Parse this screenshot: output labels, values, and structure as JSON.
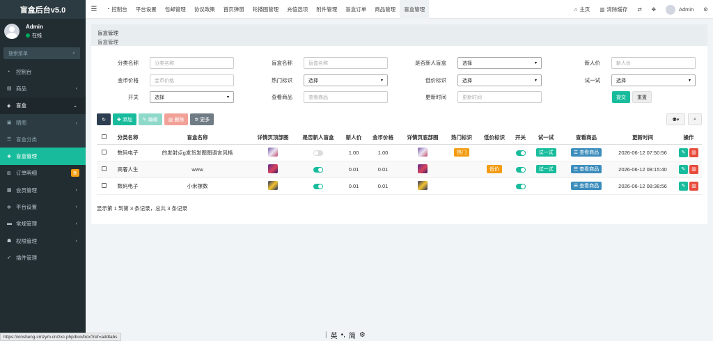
{
  "app": {
    "title": "盲盒后台v5.0"
  },
  "user": {
    "name": "Admin",
    "status": "在线"
  },
  "sidebar": {
    "search_placeholder": "搜索菜单",
    "items": [
      {
        "label": "控制台",
        "icon": "dashboard-icon"
      },
      {
        "label": "商品",
        "icon": "shop-icon",
        "chevron": "‹"
      },
      {
        "label": "盲盒",
        "icon": "cube-icon",
        "chevron": "⌄"
      },
      {
        "label": "晒图",
        "icon": "image-icon",
        "chevron": "‹"
      },
      {
        "label": "盲盒分类",
        "icon": "list-icon"
      },
      {
        "label": "盲盒管理",
        "icon": "cubes-icon"
      },
      {
        "label": "订单明细",
        "icon": "cart-icon",
        "badge": "新"
      },
      {
        "label": "会员管理",
        "icon": "users-icon",
        "chevron": "‹"
      },
      {
        "label": "平台设置",
        "icon": "cog-icon",
        "chevron": "‹"
      },
      {
        "label": "常规管理",
        "icon": "briefcase-icon",
        "chevron": "‹"
      },
      {
        "label": "权限管理",
        "icon": "group-icon",
        "chevron": "‹"
      },
      {
        "label": "插件管理",
        "icon": "rocket-icon"
      }
    ]
  },
  "header": {
    "tabs": [
      {
        "label": "控制台"
      },
      {
        "label": "平台设置"
      },
      {
        "label": "包邮管理"
      },
      {
        "label": "协议政策"
      },
      {
        "label": "首页弹窗"
      },
      {
        "label": "轮播图管理"
      },
      {
        "label": "充值选项"
      },
      {
        "label": "附件管理"
      },
      {
        "label": "盲盒订单"
      },
      {
        "label": "商品管理"
      },
      {
        "label": "盲盒管理"
      }
    ],
    "home": "主页",
    "clear_cache": "清除缓存",
    "admin": "Admin"
  },
  "panel": {
    "title": "盲盒管理",
    "subtitle": "盲盒管理"
  },
  "filters": {
    "category": {
      "label": "分类名称",
      "placeholder": "分类名称"
    },
    "name": {
      "label": "盲盒名称",
      "placeholder": "盲盒名称"
    },
    "is_new": {
      "label": "是否新人盲盒",
      "value": "选择"
    },
    "new_price": {
      "label": "新人价",
      "placeholder": "新人价"
    },
    "coin_price": {
      "label": "金币价格",
      "placeholder": "金币价格"
    },
    "hot": {
      "label": "热门标识",
      "value": "选择"
    },
    "low": {
      "label": "低价标识",
      "value": "选择"
    },
    "trial": {
      "label": "试一试",
      "value": "选择"
    },
    "switch": {
      "label": "开关",
      "value": "选择"
    },
    "view_goods": {
      "label": "查看商品",
      "placeholder": "查看商品"
    },
    "update_time": {
      "label": "更新时间",
      "placeholder": "更新时间"
    },
    "submit": "提交",
    "reset": "重置"
  },
  "toolbar": {
    "add": "添加",
    "edit": "编辑",
    "delete": "删除",
    "more": "更多"
  },
  "table": {
    "headers": [
      "分类名称",
      "盲盒名称",
      "详情页顶部图",
      "是否新人盲盒",
      "新人价",
      "金币价格",
      "详情页底部图",
      "热门标识",
      "低价标识",
      "开关",
      "试一试",
      "查看商品",
      "更新时间",
      "操作"
    ],
    "rows": [
      {
        "category": "数码电子",
        "name": "的发射点g发货发图图语言风格",
        "thumb_top": "a",
        "is_new": false,
        "new_price": "1.00",
        "coin_price": "1.00",
        "thumb_bottom": "a",
        "hot": "热门",
        "low": "",
        "switch": true,
        "trial": "试一试",
        "view": "查看商品",
        "time": "2026-06-12 07:50:56"
      },
      {
        "category": "高奢人生",
        "name": "www",
        "thumb_top": "b",
        "is_new": true,
        "new_price": "0.01",
        "coin_price": "0.01",
        "thumb_bottom": "b",
        "hot": "",
        "low": "低价",
        "switch": true,
        "trial": "试一试",
        "view": "查看商品",
        "time": "2026-06-12 08:15:40"
      },
      {
        "category": "数码电子",
        "name": "小米摞数",
        "thumb_top": "c",
        "is_new": true,
        "new_price": "0.01",
        "coin_price": "0.01",
        "thumb_bottom": "c",
        "hot": "",
        "low": "",
        "switch": true,
        "trial": "",
        "view": "查看商品",
        "time": "2026-06-12 08:38:56"
      }
    ]
  },
  "pager": {
    "info": "显示第 1 到第 3 条记录，总共 3 条记录"
  },
  "statusbar": {
    "url": "https://xinsheng.cmzym.cn/zxc.php/box/box?ref=addtabs"
  },
  "ime": {
    "lang": "英",
    "punct": "•,",
    "mode": "简",
    "settings": "⚙"
  },
  "colors": {
    "sidebar": "#222d32",
    "accent": "#18bc9c",
    "hot": "#f39c12",
    "danger": "#e74c3c",
    "blue": "#3c8dbc"
  }
}
